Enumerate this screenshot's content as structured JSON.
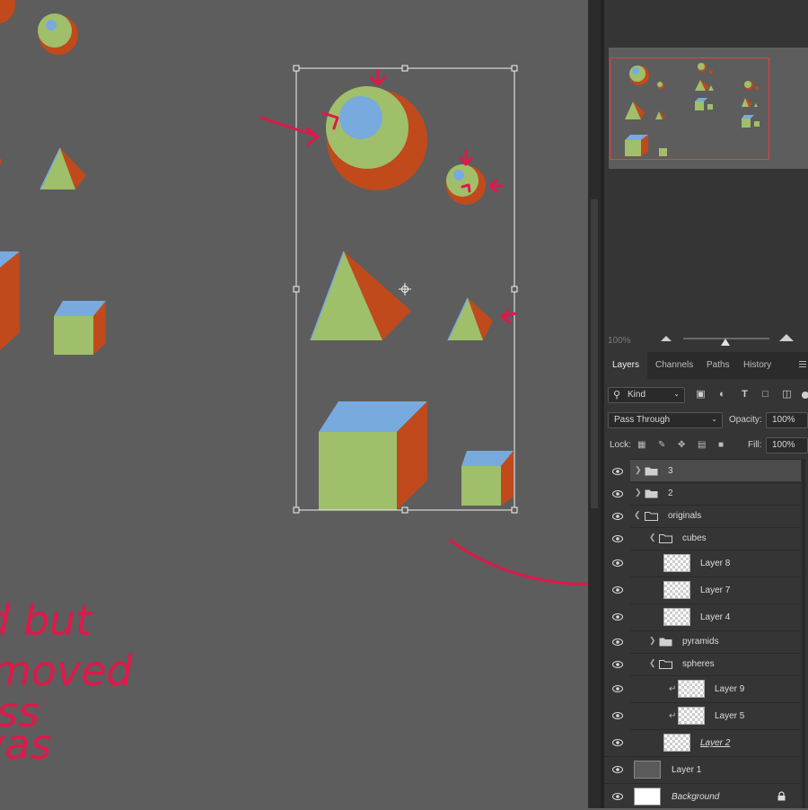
{
  "canvas": {
    "handwritten_lines": [
      "d but",
      "moved",
      "ss",
      "vas"
    ]
  },
  "navigator": {
    "zoom": "100%"
  },
  "panel": {
    "tabs": [
      {
        "label": "Layers",
        "active": true
      },
      {
        "label": "Channels",
        "active": false
      },
      {
        "label": "Paths",
        "active": false
      },
      {
        "label": "History",
        "active": false
      }
    ],
    "filter": {
      "kind": "Kind"
    },
    "blend_mode": "Pass Through",
    "opacity_label": "Opacity:",
    "opacity_value": "100%",
    "lock_label": "Lock:",
    "fill_label": "Fill:",
    "fill_value": "100%"
  },
  "layers": [
    {
      "name": "3",
      "type": "group",
      "expanded": false,
      "depth": 0,
      "selected": true
    },
    {
      "name": "2",
      "type": "group",
      "expanded": false,
      "depth": 0
    },
    {
      "name": "originals",
      "type": "group",
      "expanded": true,
      "depth": 0
    },
    {
      "name": "cubes",
      "type": "group",
      "expanded": true,
      "depth": 1
    },
    {
      "name": "Layer 8",
      "type": "layer",
      "depth": 2
    },
    {
      "name": "Layer 7",
      "type": "layer",
      "depth": 2
    },
    {
      "name": "Layer 4",
      "type": "layer",
      "depth": 2
    },
    {
      "name": "pyramids",
      "type": "group",
      "expanded": false,
      "depth": 1
    },
    {
      "name": "spheres",
      "type": "group",
      "expanded": true,
      "depth": 1
    },
    {
      "name": "Layer 9",
      "type": "layer",
      "depth": 2,
      "clipped": true
    },
    {
      "name": "Layer 5",
      "type": "layer",
      "depth": 2,
      "clipped": true
    },
    {
      "name": "Layer 2",
      "type": "layer",
      "depth": 2
    },
    {
      "name": "Layer 1",
      "type": "layer",
      "depth": 0,
      "fill": "#5a5a5a"
    },
    {
      "name": "Background",
      "type": "background",
      "depth": 0,
      "locked": true
    }
  ],
  "colors": {
    "shape_green": "#a0bf6a",
    "shape_orange": "#c04a1c",
    "shape_blue": "#78aade",
    "annotation": "#e0184a"
  }
}
